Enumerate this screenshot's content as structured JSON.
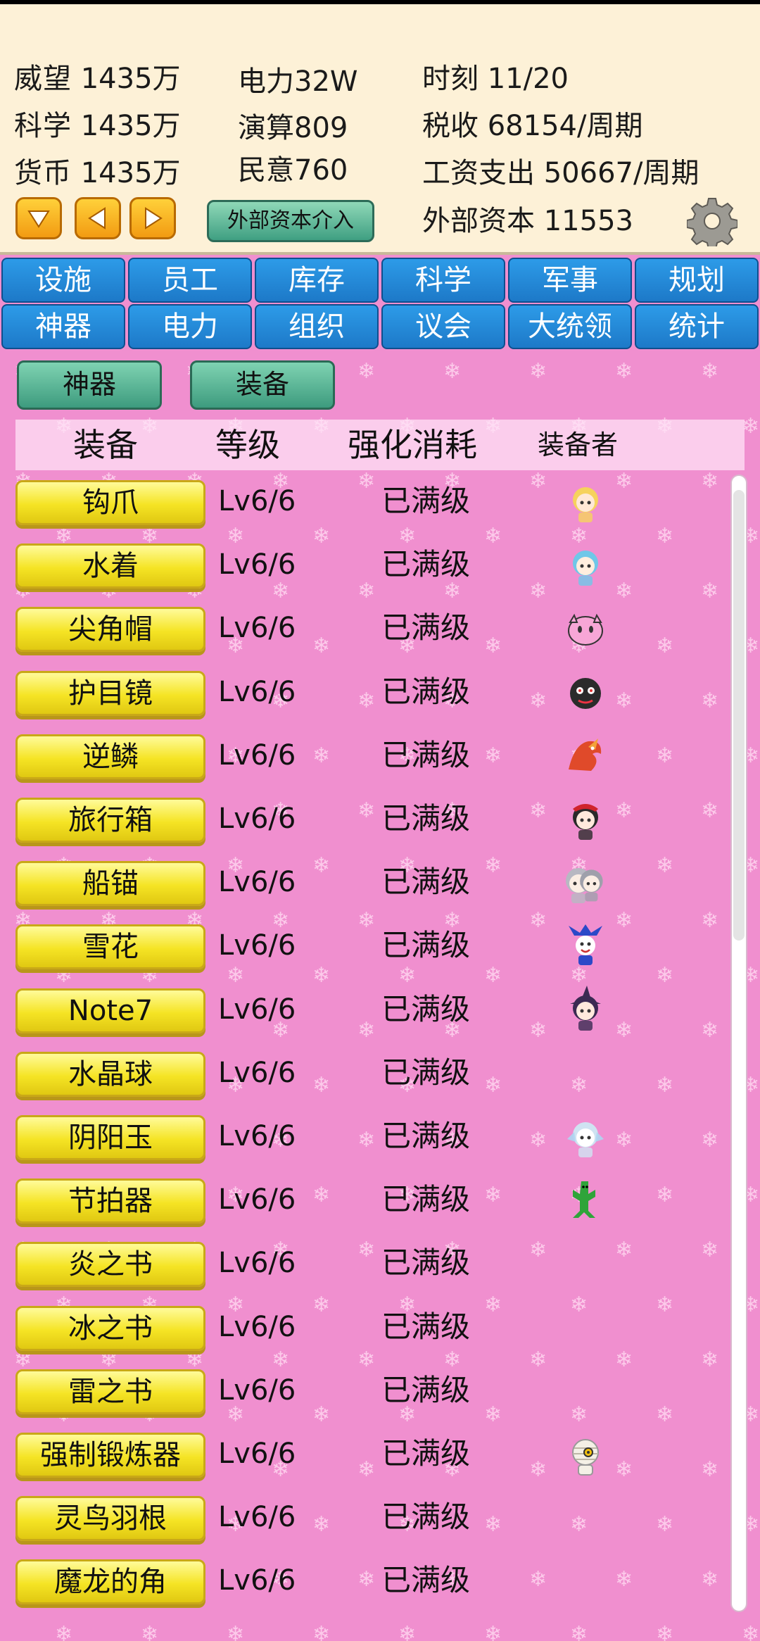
{
  "stats": {
    "prestige": {
      "label": "威望",
      "value": "1435万"
    },
    "science": {
      "label": "科学",
      "value": "1435万"
    },
    "currency": {
      "label": "货币",
      "value": "1435万"
    },
    "power": {
      "label": "电力",
      "value": "32W"
    },
    "compute": {
      "label": "演算",
      "value": "809"
    },
    "public_opinion": {
      "label": "民意",
      "value": "760"
    },
    "time": {
      "label": "时刻",
      "value": "11/20"
    },
    "tax": {
      "label": "税收",
      "value": "68154/周期"
    },
    "wage": {
      "label": "工资支出",
      "value": "50667/周期"
    },
    "external_capital": {
      "label": "外部资本",
      "value": "11553"
    }
  },
  "controls": {
    "capital_button": "外部资本介入",
    "down_icon": "arrow-down-icon",
    "left_icon": "arrow-left-icon",
    "right_icon": "arrow-right-icon",
    "settings_icon": "gear-icon"
  },
  "tabs_row1": [
    "设施",
    "员工",
    "库存",
    "科学",
    "军事",
    "规划"
  ],
  "tabs_row2": [
    "神器",
    "电力",
    "组织",
    "议会",
    "大统领",
    "统计"
  ],
  "subtabs": [
    "神器",
    "装备"
  ],
  "table": {
    "headers": [
      "装备",
      "等级",
      "强化消耗",
      "装备者"
    ],
    "rows": [
      {
        "name": "钩爪",
        "level": "Lv6/6",
        "cost": "已满级",
        "owner": "blonde-girl"
      },
      {
        "name": "水着",
        "level": "Lv6/6",
        "cost": "已满级",
        "owner": "blue-hair-girl"
      },
      {
        "name": "尖角帽",
        "level": "Lv6/6",
        "cost": "已满级",
        "owner": "pink-blob"
      },
      {
        "name": "护目镜",
        "level": "Lv6/6",
        "cost": "已满级",
        "owner": "bomb-creature"
      },
      {
        "name": "逆鳞",
        "level": "Lv6/6",
        "cost": "已满级",
        "owner": "red-dragon"
      },
      {
        "name": "旅行箱",
        "level": "Lv6/6",
        "cost": "已满级",
        "owner": "shrine-maiden"
      },
      {
        "name": "船锚",
        "level": "Lv6/6",
        "cost": "已满级",
        "owner": "silver-girls"
      },
      {
        "name": "雪花",
        "level": "Lv6/6",
        "cost": "已满级",
        "owner": "jack-frost"
      },
      {
        "name": "Note7",
        "level": "Lv6/6",
        "cost": "已满级",
        "owner": "witch"
      },
      {
        "name": "水晶球",
        "level": "Lv6/6",
        "cost": "已满级",
        "owner": ""
      },
      {
        "name": "阴阳玉",
        "level": "Lv6/6",
        "cost": "已满级",
        "owner": "ice-fairy"
      },
      {
        "name": "节拍器",
        "level": "Lv6/6",
        "cost": "已满级",
        "owner": "cactuar"
      },
      {
        "name": "炎之书",
        "level": "Lv6/6",
        "cost": "已满级",
        "owner": ""
      },
      {
        "name": "冰之书",
        "level": "Lv6/6",
        "cost": "已满级",
        "owner": ""
      },
      {
        "name": "雷之书",
        "level": "Lv6/6",
        "cost": "已满级",
        "owner": ""
      },
      {
        "name": "强制锻炼器",
        "level": "Lv6/6",
        "cost": "已满级",
        "owner": "mummy"
      },
      {
        "name": "灵鸟羽根",
        "level": "Lv6/6",
        "cost": "已满级",
        "owner": ""
      },
      {
        "name": "魔龙的角",
        "level": "Lv6/6",
        "cost": "已满级",
        "owner": ""
      }
    ]
  }
}
